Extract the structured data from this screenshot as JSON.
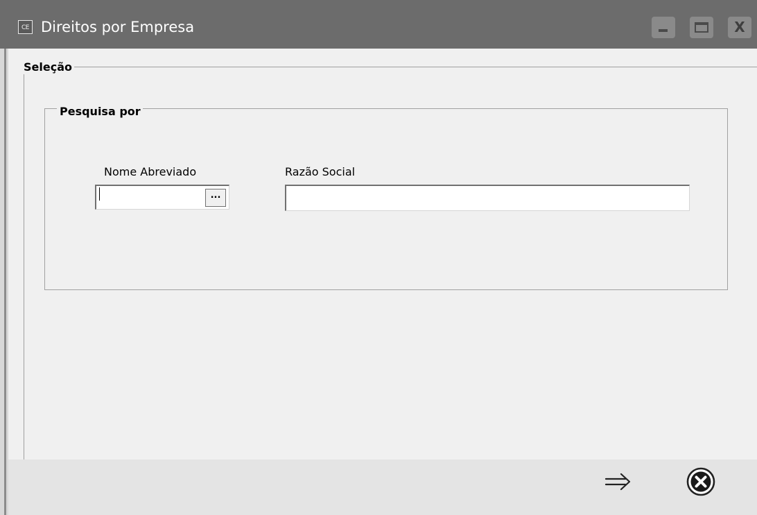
{
  "window": {
    "title": "Direitos por Empresa",
    "icon_label": "CE",
    "controls": {
      "minimize": "minimize-icon",
      "maximize": "maximize-icon",
      "close": "close-icon",
      "close_glyph": "X"
    }
  },
  "selection_group": {
    "label": "Seleção",
    "search_group": {
      "label": "Pesquisa por",
      "fields": {
        "short_name": {
          "label": "Nome Abreviado",
          "value": "",
          "lookup_button_label": "..."
        },
        "company_name": {
          "label": "Razão Social",
          "value": ""
        }
      }
    }
  },
  "footer": {
    "next_icon": "arrow-right-icon",
    "cancel_icon": "close-circle-icon"
  },
  "colors": {
    "titlebar": "#6c6c6c",
    "client_bg": "#f0f0f0",
    "footer_bg": "#e4e4e4",
    "group_border": "#a0a0a0"
  }
}
